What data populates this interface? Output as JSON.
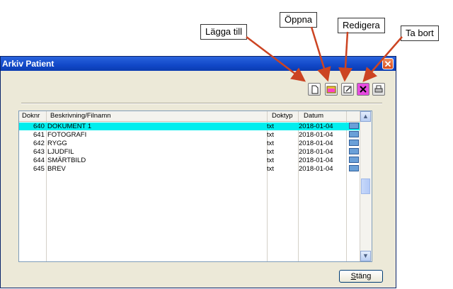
{
  "callouts": {
    "add": "Lägga till",
    "open": "Öppna",
    "edit": "Redigera",
    "delete": "Ta bort"
  },
  "window": {
    "title": "Arkiv Patient"
  },
  "toolbar": {
    "icons": [
      "new-document-icon",
      "open-folder-icon",
      "edit-icon",
      "delete-icon",
      "print-icon"
    ]
  },
  "table": {
    "headers": [
      "Doknr",
      "Beskrivning/Filnamn",
      "Doktyp",
      "Datum"
    ],
    "rows": [
      {
        "doknr": "640",
        "desc": "DOKUMENT 1",
        "type": "txt",
        "date": "2018-01-04"
      },
      {
        "doknr": "641",
        "desc": "FOTOGRAFI",
        "type": "txt",
        "date": "2018-01-04"
      },
      {
        "doknr": "642",
        "desc": "RYGG",
        "type": "txt",
        "date": "2018-01-04"
      },
      {
        "doknr": "643",
        "desc": "LJUDFIL",
        "type": "txt",
        "date": "2018-01-04"
      },
      {
        "doknr": "644",
        "desc": "SMÄRTBILD",
        "type": "txt",
        "date": "2018-01-04"
      },
      {
        "doknr": "645",
        "desc": "BREV",
        "type": "txt",
        "date": "2018-01-04"
      }
    ],
    "selected_row": 0
  },
  "close_button": {
    "label_first": "S",
    "label_rest": "täng"
  },
  "colors": {
    "selection": "#00eeee",
    "title_bar": "#1148c8",
    "arrow": "#cc4422"
  }
}
